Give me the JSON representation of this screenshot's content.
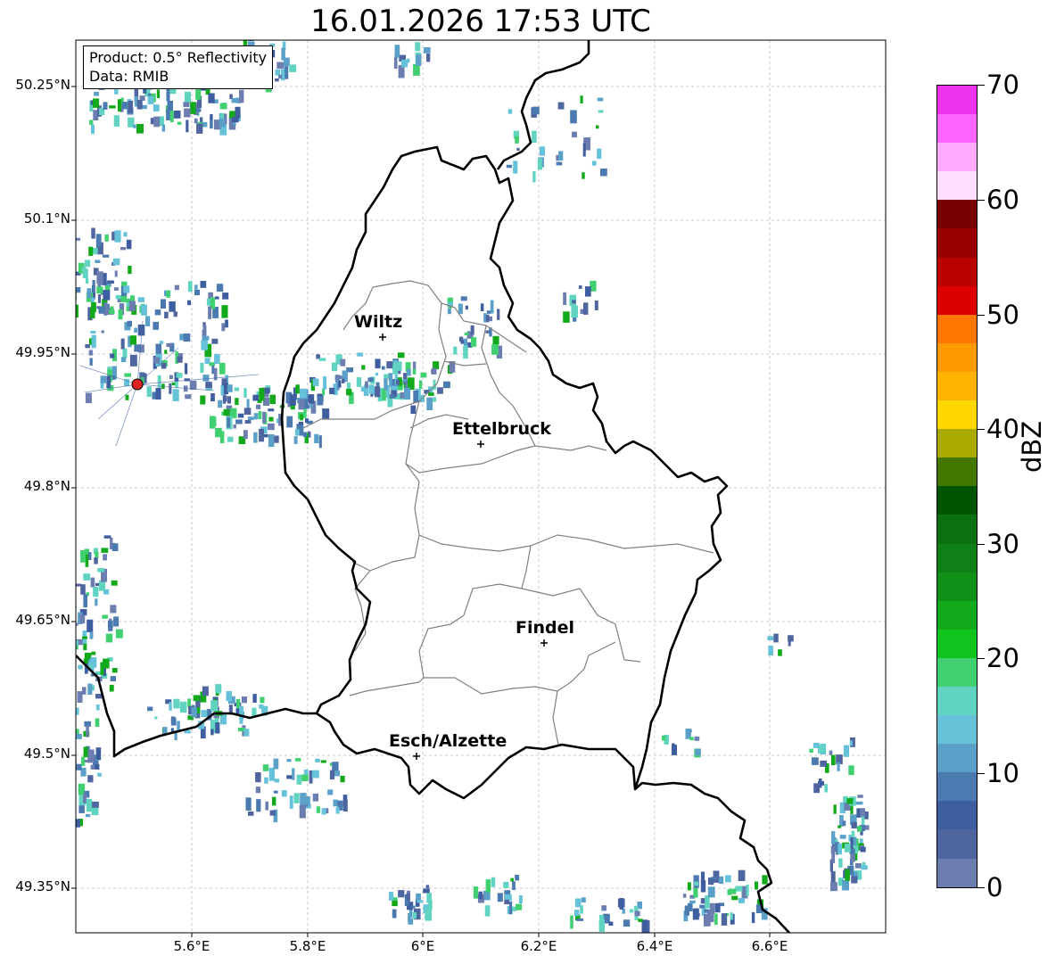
{
  "title": "16.01.2026 17:53 UTC",
  "info": {
    "product": "Product: 0.5° Reflectivity",
    "data": "Data: RMIB"
  },
  "axes": {
    "lat_labels": [
      "50.25°N",
      "50.1°N",
      "49.95°N",
      "49.8°N",
      "49.65°N",
      "49.5°N",
      "49.35°N"
    ],
    "lon_labels": [
      "5.6°E",
      "5.8°E",
      "6°E",
      "6.2°E",
      "6.4°E",
      "6.6°E"
    ]
  },
  "colorbar": {
    "unit": "dBZ",
    "tick_labels": [
      "70",
      "60",
      "50",
      "40",
      "30",
      "20",
      "10",
      "0"
    ],
    "colors": [
      "#ee33ee",
      "#ff66ff",
      "#ffaaff",
      "#ffddff",
      "#780000",
      "#990000",
      "#bb0000",
      "#dd0000",
      "#ff7700",
      "#ff9900",
      "#ffb300",
      "#ffd700",
      "#aaaa00",
      "#447700",
      "#005500",
      "#0a7010",
      "#0f8015",
      "#119018",
      "#12aa1a",
      "#10c41e",
      "#40d070",
      "#60d4c0",
      "#66c2d8",
      "#5aa0c8",
      "#4a7ab0",
      "#3f5ea0",
      "#4f65a0",
      "#6c7db0"
    ]
  },
  "map": {
    "radar_color": "#dd2222",
    "cities": [
      {
        "name": "Wiltz"
      },
      {
        "name": "Ettelbruck"
      },
      {
        "name": "Findel"
      },
      {
        "name": "Esch/Alzette"
      }
    ]
  }
}
